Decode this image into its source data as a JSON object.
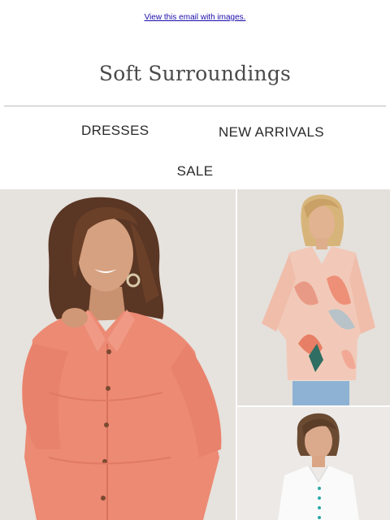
{
  "header": {
    "view_link": "View this email with images."
  },
  "brand": {
    "logo_text": "Soft Surroundings"
  },
  "nav": {
    "dresses": "DRESSES",
    "new_arrivals": "NEW ARRIVALS",
    "sale": "SALE"
  },
  "colors": {
    "link": "#1a0dab",
    "text": "#2b2b2b",
    "divider": "#bdbdbd",
    "coral_shirt": "#ec8a74"
  }
}
